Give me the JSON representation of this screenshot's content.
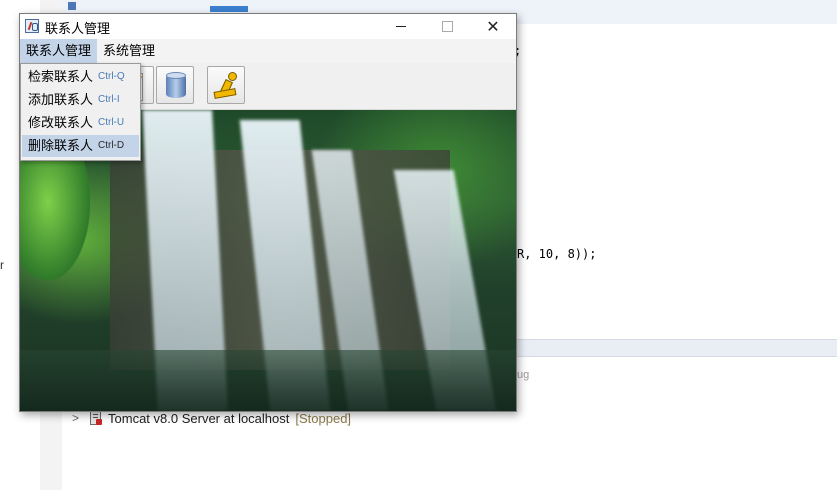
{
  "ide": {
    "code_line": "R, 10, 8));",
    "code_semicolon": ";",
    "servers_faded": "ug",
    "edge_letter": "r",
    "server_row": {
      "name": "Tomcat v8.0 Server at localhost",
      "status": "[Stopped]"
    }
  },
  "window": {
    "title": "联系人管理",
    "menus": [
      "联系人管理",
      "系统管理"
    ],
    "dropdown": [
      {
        "label": "检索联系人",
        "accel": "Ctrl-Q"
      },
      {
        "label": "添加联系人",
        "accel": "Ctrl-I"
      },
      {
        "label": "修改联系人",
        "accel": "Ctrl-U"
      },
      {
        "label": "删除联系人",
        "accel": "Ctrl-D"
      }
    ],
    "toolbar_icons": [
      "edit-icon",
      "database-icon",
      "aim-running-man-icon"
    ]
  },
  "colors": {
    "menu_highlight": "#c3d3e8",
    "accelerator_text": "#4a7ab8"
  }
}
